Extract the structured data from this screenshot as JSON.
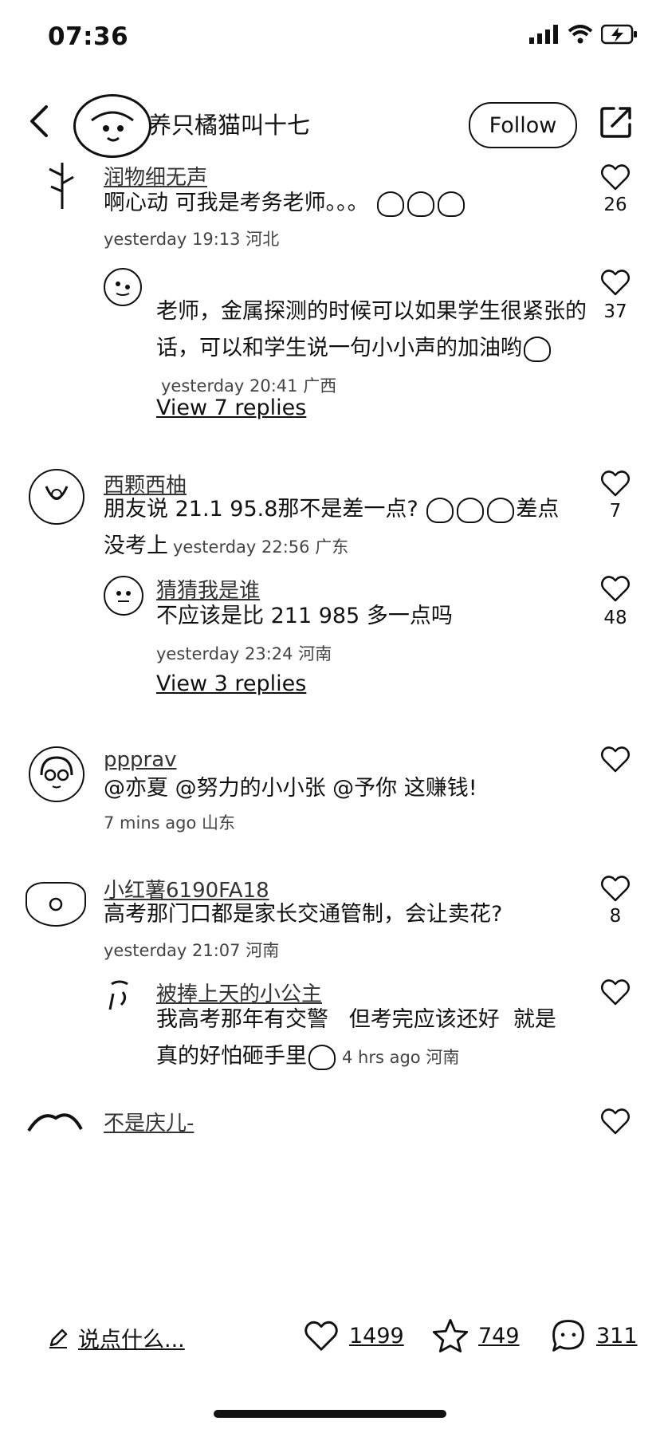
{
  "status_bar": {
    "time": "07:36"
  },
  "header": {
    "author_name": "养只橘猫叫十七",
    "follow_label": "Follow"
  },
  "comments": [
    {
      "username": "润物细无声",
      "text": "啊心动 可我是考务老师。。。",
      "meta": "yesterday 19:13 河北",
      "likes": "26",
      "reply": {
        "text": "老师，金属探测的时候可以如果学生很紧张的话，可以和学生说一句小小声的加油哟",
        "meta": "yesterday 20:41 广西",
        "likes": "37"
      },
      "view_replies": "View 7 replies"
    },
    {
      "username": "西颗西柚",
      "text": "朋友说 21.1 95.8那不是差一点?",
      "text_tail": "差点",
      "text_line2": "没考上",
      "meta": "yesterday 22:56 广东",
      "likes": "7",
      "reply": {
        "username": "猜猜我是谁",
        "text": "不应该是比 211 985 多一点吗",
        "meta": "yesterday 23:24 河南",
        "likes": "48"
      },
      "view_replies": "View 3 replies"
    },
    {
      "username": "ppprav",
      "text": "@亦夏 @努力的小小张 @予你 这赚钱!",
      "meta": "7 mins ago 山东",
      "likes": ""
    },
    {
      "username": "小红薯6190FA18",
      "text": "高考那门口都是家长交通管制，会让卖花?",
      "meta": "yesterday 21:07 河南",
      "likes": "8",
      "reply": {
        "username": "被捧上天的小公主",
        "text_line1": "我高考那年有交警   但考完应该还好  就是",
        "text_line2": "真的好怕砸手里",
        "meta": "4 hrs ago 河南",
        "likes": ""
      }
    },
    {
      "username": "不是庆儿-",
      "likes": ""
    }
  ],
  "bottom_bar": {
    "input_placeholder": "说点什么...",
    "likes": "1499",
    "stars": "749",
    "comments": "311"
  }
}
